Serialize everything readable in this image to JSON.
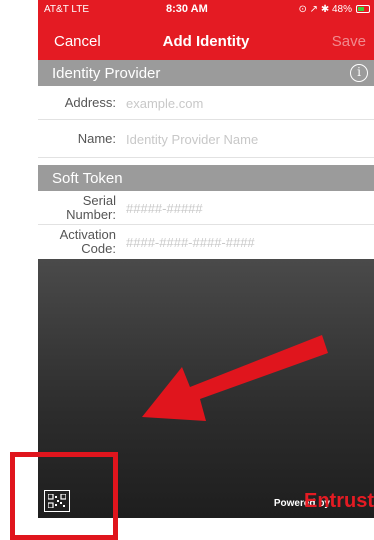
{
  "status_bar": {
    "carrier": "AT&T  LTE",
    "time": "8:30 AM",
    "indicators": "⊙ ↗ ✱ 48%"
  },
  "nav_bar": {
    "cancel_label": "Cancel",
    "title": "Add Identity",
    "save_label": "Save"
  },
  "identity_provider": {
    "header": "Identity Provider",
    "info_icon": "i",
    "address_label": "Address:",
    "address_placeholder": "example.com",
    "name_label": "Name:",
    "name_placeholder": "Identity Provider Name"
  },
  "soft_token": {
    "header": "Soft Token",
    "serial_label_line1": "Serial",
    "serial_label_line2": "Number:",
    "serial_placeholder": "#####-#####",
    "activation_label_line1": "Activation",
    "activation_label_line2": "Code:",
    "activation_placeholder": "####-####-####-####"
  },
  "footer": {
    "qr_icon": "qr-code-icon",
    "powered_by": "Powered by",
    "brand": "Entrust"
  },
  "colors": {
    "accent_red": "#e41b23",
    "section_gray": "#9b9b9b",
    "dark_background": "#2a2a2a"
  }
}
